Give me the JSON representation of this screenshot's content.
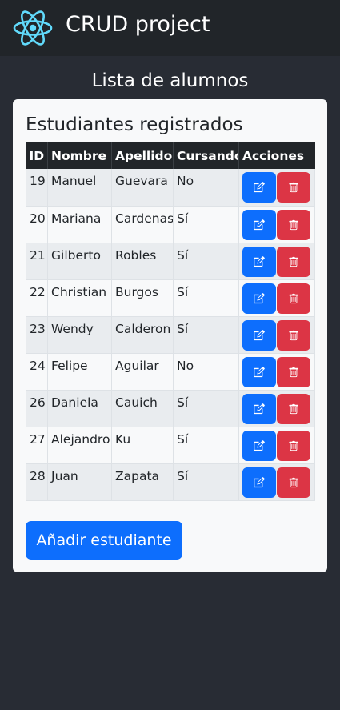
{
  "navbar": {
    "brand": "CRUD project",
    "logo_icon": "react-logo-icon"
  },
  "page": {
    "title": "Lista de alumnos"
  },
  "card": {
    "title": "Estudiantes registrados",
    "add_button": "Añadir estudiante"
  },
  "table": {
    "headers": [
      "ID",
      "Nombre",
      "Apellido",
      "Cursando",
      "Acciones"
    ],
    "rows": [
      {
        "id": "19",
        "nombre": "Manuel",
        "apellido": "Guevara",
        "cursando": "No"
      },
      {
        "id": "20",
        "nombre": "Mariana",
        "apellido": "Cardenas",
        "cursando": "Sí"
      },
      {
        "id": "21",
        "nombre": "Gilberto",
        "apellido": "Robles",
        "cursando": "Sí"
      },
      {
        "id": "22",
        "nombre": "Christian",
        "apellido": "Burgos",
        "cursando": "Sí"
      },
      {
        "id": "23",
        "nombre": "Wendy",
        "apellido": "Calderon",
        "cursando": "Sí"
      },
      {
        "id": "24",
        "nombre": "Felipe",
        "apellido": "Aguilar",
        "cursando": "No"
      },
      {
        "id": "26",
        "nombre": "Daniela",
        "apellido": "Cauich",
        "cursando": "Sí"
      },
      {
        "id": "27",
        "nombre": "Alejandro",
        "apellido": "Ku",
        "cursando": "Sí"
      },
      {
        "id": "28",
        "nombre": "Juan",
        "apellido": "Zapata",
        "cursando": "Sí"
      }
    ],
    "edit_icon": "pencil-square-icon",
    "delete_icon": "trash-icon"
  },
  "colors": {
    "background": "#282c34",
    "navbar": "#212529",
    "primary": "#0d6efd",
    "danger": "#dc3545",
    "react_blue": "#61dafb"
  }
}
